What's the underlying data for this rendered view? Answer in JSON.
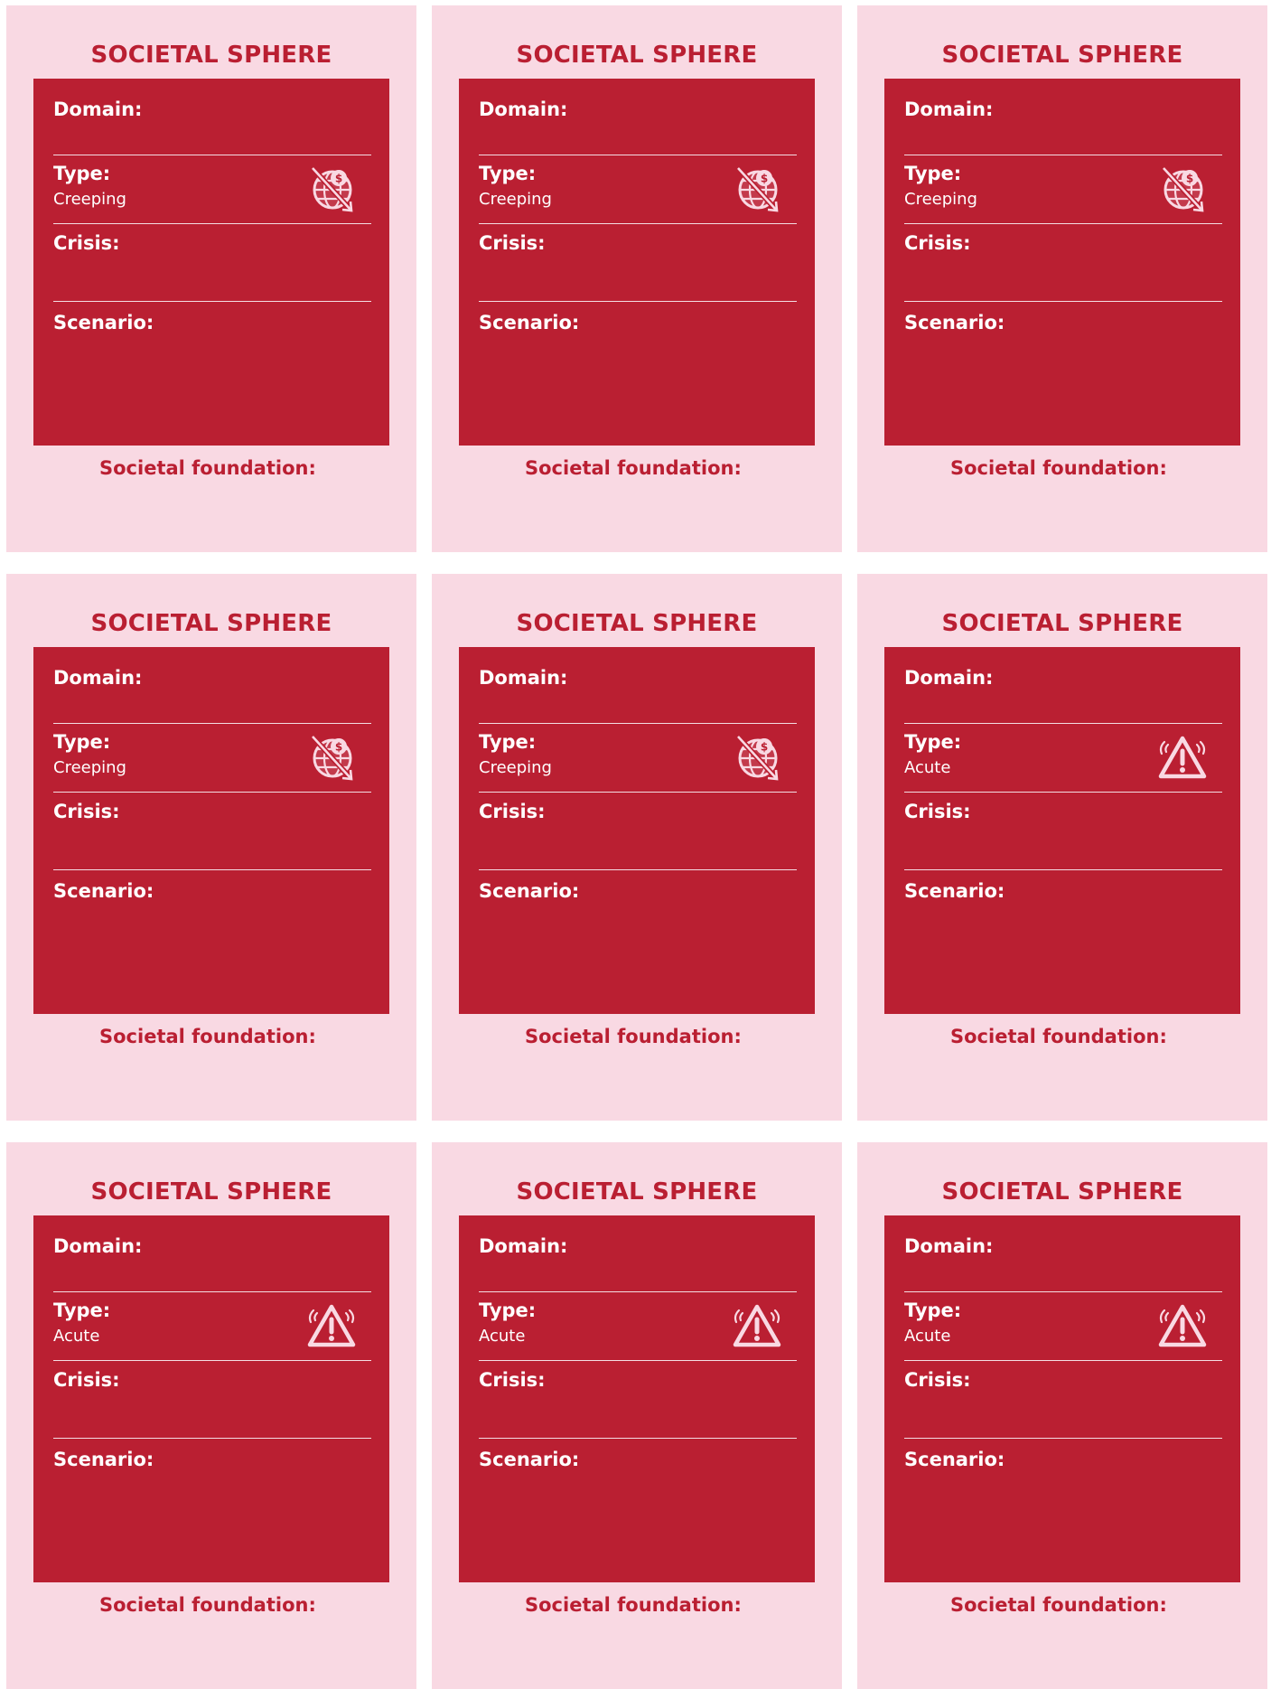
{
  "cards": [
    {
      "title": "SOCIETAL SPHERE",
      "domain_label": "Domain:",
      "type_label": "Type:",
      "type_value": "Creeping",
      "icon": "creeping-crisis-globe-icon",
      "crisis_label": "Crisis:",
      "scenario_label": "Scenario:",
      "foundation_label": "Societal foundation:"
    },
    {
      "title": "SOCIETAL SPHERE",
      "domain_label": "Domain:",
      "type_label": "Type:",
      "type_value": "Creeping",
      "icon": "creeping-crisis-globe-icon",
      "crisis_label": "Crisis:",
      "scenario_label": "Scenario:",
      "foundation_label": "Societal foundation:"
    },
    {
      "title": "SOCIETAL SPHERE",
      "domain_label": "Domain:",
      "type_label": "Type:",
      "type_value": "Creeping",
      "icon": "creeping-crisis-globe-icon",
      "crisis_label": "Crisis:",
      "scenario_label": "Scenario:",
      "foundation_label": "Societal foundation:"
    },
    {
      "title": "SOCIETAL SPHERE",
      "domain_label": "Domain:",
      "type_label": "Type:",
      "type_value": "Creeping",
      "icon": "creeping-crisis-globe-icon",
      "crisis_label": "Crisis:",
      "scenario_label": "Scenario:",
      "foundation_label": "Societal foundation:"
    },
    {
      "title": "SOCIETAL SPHERE",
      "domain_label": "Domain:",
      "type_label": "Type:",
      "type_value": "Creeping",
      "icon": "creeping-crisis-globe-icon",
      "crisis_label": "Crisis:",
      "scenario_label": "Scenario:",
      "foundation_label": "Societal foundation:"
    },
    {
      "title": "SOCIETAL SPHERE",
      "domain_label": "Domain:",
      "type_label": "Type:",
      "type_value": "Acute",
      "icon": "acute-warning-icon",
      "crisis_label": "Crisis:",
      "scenario_label": "Scenario:",
      "foundation_label": "Societal foundation:"
    },
    {
      "title": "SOCIETAL SPHERE",
      "domain_label": "Domain:",
      "type_label": "Type:",
      "type_value": "Acute",
      "icon": "acute-warning-icon",
      "crisis_label": "Crisis:",
      "scenario_label": "Scenario:",
      "foundation_label": "Societal foundation:"
    },
    {
      "title": "SOCIETAL SPHERE",
      "domain_label": "Domain:",
      "type_label": "Type:",
      "type_value": "Acute",
      "icon": "acute-warning-icon",
      "crisis_label": "Crisis:",
      "scenario_label": "Scenario:",
      "foundation_label": "Societal foundation:"
    },
    {
      "title": "SOCIETAL SPHERE",
      "domain_label": "Domain:",
      "type_label": "Type:",
      "type_value": "Acute",
      "icon": "acute-warning-icon",
      "crisis_label": "Crisis:",
      "scenario_label": "Scenario:",
      "foundation_label": "Societal foundation:"
    }
  ],
  "colors": {
    "card_bg": "#f9d9e3",
    "panel_red": "#ba1f32",
    "text_white": "#ffffff"
  }
}
